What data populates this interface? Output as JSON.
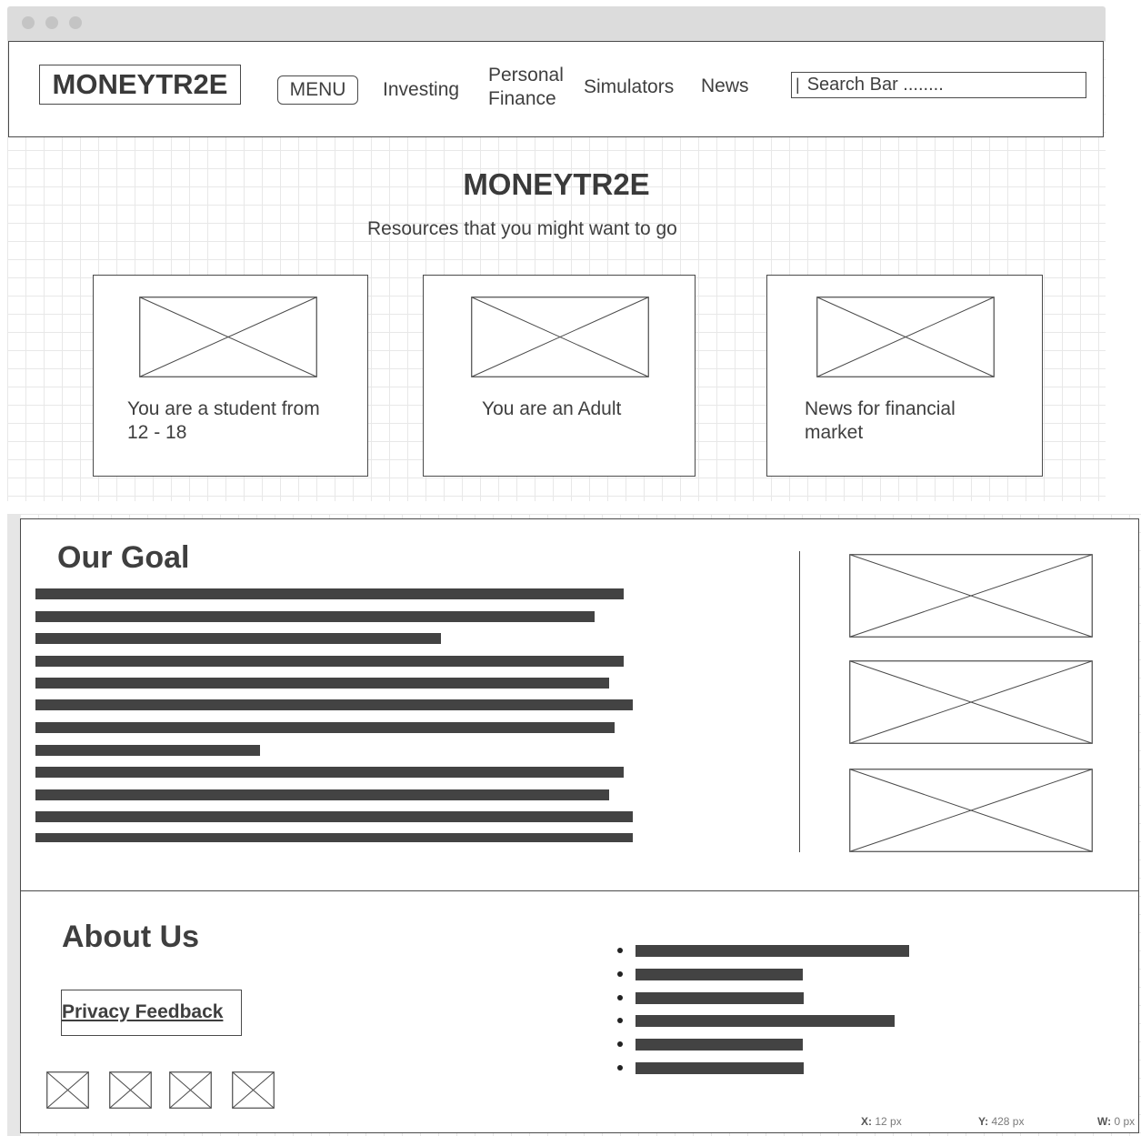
{
  "header": {
    "logo": "MONEYTR2E",
    "menu_label": "MENU",
    "nav": {
      "investing": "Investing",
      "personal_finance": "Personal Finance",
      "simulators": "Simulators",
      "news": "News"
    },
    "search_text": "Search Bar ........"
  },
  "hero": {
    "title": "MONEYTR2E",
    "subtitle": "Resources that you might want to go"
  },
  "cards": [
    {
      "label": "You are a student from 12 - 18"
    },
    {
      "label": "You are an Adult"
    },
    {
      "label": "News for financial market"
    }
  ],
  "goal": {
    "title": "Our Goal"
  },
  "about": {
    "title": "About Us",
    "privacy_feedback": "Privacy Feedback"
  },
  "status": {
    "x_label": "X:",
    "x_value": "12 px",
    "y_label": "Y:",
    "y_value": "428 px",
    "w_label": "W:",
    "w_value": "0 px"
  }
}
